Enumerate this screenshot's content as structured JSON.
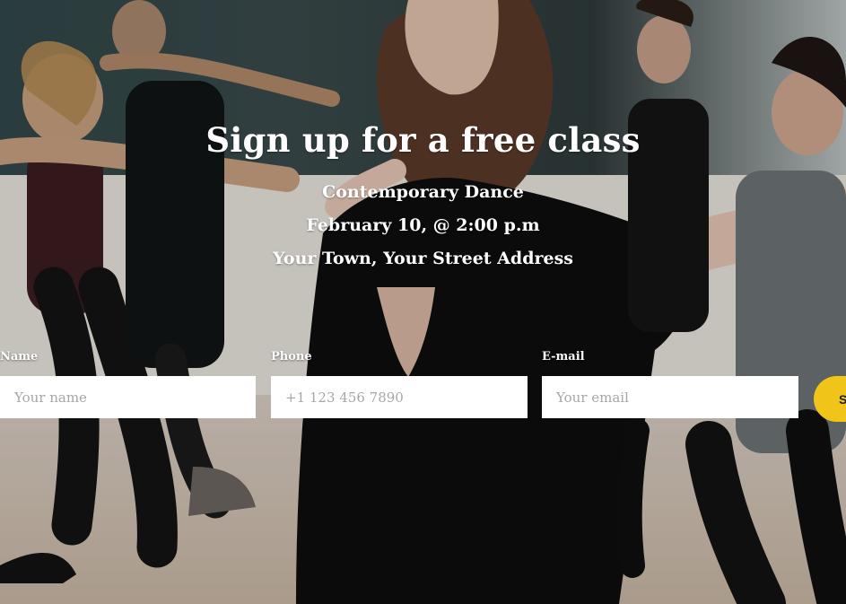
{
  "hero": {
    "title": "Sign up for a free class",
    "class_name": "Contemporary Dance",
    "date_time": "February 10, @ 2:00 p.m",
    "address": "Your Town, Your Street Address"
  },
  "form": {
    "name": {
      "label": "Name",
      "placeholder": "Your name",
      "value": ""
    },
    "phone": {
      "label": "Phone",
      "placeholder": "+1 123 456 7890",
      "value": ""
    },
    "email": {
      "label": "E-mail",
      "placeholder": "Your email",
      "value": ""
    },
    "submit_label": "S"
  },
  "colors": {
    "accent": "#f0c419"
  }
}
